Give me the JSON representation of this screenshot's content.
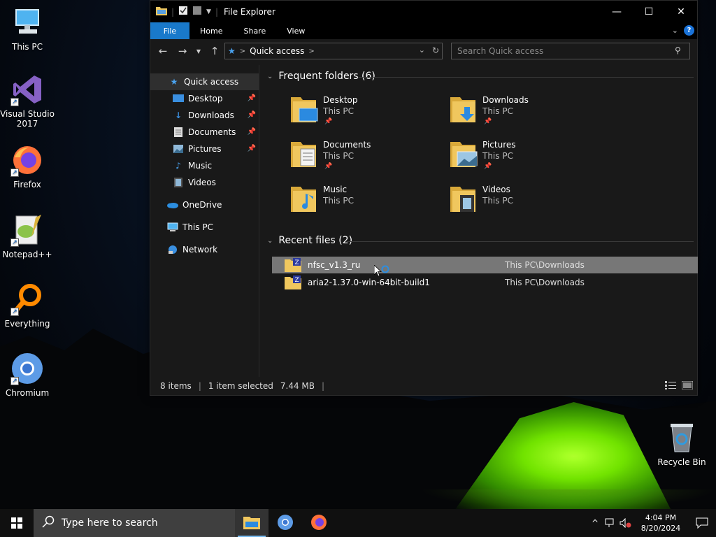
{
  "desktop": {
    "icons": [
      {
        "label_line1": "This PC",
        "label_line2": ""
      },
      {
        "label_line1": "Visual Studio",
        "label_line2": "2017"
      },
      {
        "label_line1": "Firefox",
        "label_line2": ""
      },
      {
        "label_line1": "Notepad++",
        "label_line2": ""
      },
      {
        "label_line1": "Everything",
        "label_line2": ""
      },
      {
        "label_line1": "Chromium",
        "label_line2": ""
      },
      {
        "label_line1": "Recycle Bin",
        "label_line2": ""
      }
    ]
  },
  "window": {
    "title": "File Explorer",
    "controls": {
      "minimize": "—",
      "maximize": "☐",
      "close": "✕"
    },
    "ribbon_tabs": [
      "File",
      "Home",
      "Share",
      "View"
    ],
    "address": {
      "crumb_separator": ">",
      "location": "Quick access"
    },
    "search": {
      "placeholder": "Search Quick access"
    },
    "nav": {
      "quick_access": "Quick access",
      "items": [
        {
          "label": "Desktop",
          "pinned": true
        },
        {
          "label": "Downloads",
          "pinned": true
        },
        {
          "label": "Documents",
          "pinned": true
        },
        {
          "label": "Pictures",
          "pinned": true
        },
        {
          "label": "Music",
          "pinned": false
        },
        {
          "label": "Videos",
          "pinned": false
        }
      ],
      "onedrive": "OneDrive",
      "this_pc": "This PC",
      "network": "Network"
    },
    "frequent": {
      "header": "Frequent folders (6)",
      "folders": [
        {
          "name": "Desktop",
          "location": "This PC",
          "pinned": true
        },
        {
          "name": "Downloads",
          "location": "This PC",
          "pinned": true
        },
        {
          "name": "Documents",
          "location": "This PC",
          "pinned": true
        },
        {
          "name": "Pictures",
          "location": "This PC",
          "pinned": true
        },
        {
          "name": "Music",
          "location": "This PC",
          "pinned": false
        },
        {
          "name": "Videos",
          "location": "This PC",
          "pinned": false
        }
      ]
    },
    "recent": {
      "header": "Recent files (2)",
      "files": [
        {
          "name": "nfsc_v1.3_ru",
          "path": "This PC\\Downloads",
          "selected": true
        },
        {
          "name": "aria2-1.37.0-win-64bit-build1",
          "path": "This PC\\Downloads",
          "selected": false
        }
      ]
    },
    "status": {
      "items": "8 items",
      "selected": "1 item selected",
      "size": "7.44 MB"
    }
  },
  "taskbar": {
    "search_placeholder": "Type here to search",
    "time": "4:04 PM",
    "date": "8/20/2024"
  },
  "colors": {
    "accent": "#1979ca",
    "folder": "#f0c75e",
    "selection": "#777777"
  }
}
